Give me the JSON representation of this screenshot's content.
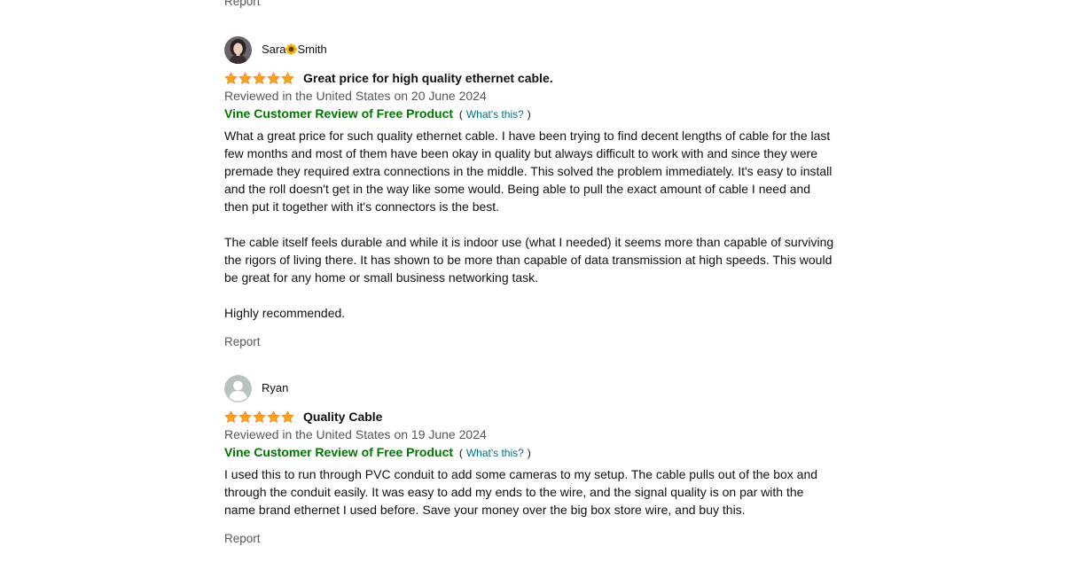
{
  "top_report": {
    "label": "Report"
  },
  "reviews": [
    {
      "author": {
        "name_first": "Sara",
        "name_last": "Smith",
        "emoji_icon": "sunflower-icon"
      },
      "rating": 5,
      "rating_max": 5,
      "title": "Great price for high quality ethernet cable.",
      "date": "Reviewed in the United States on 20 June 2024",
      "vine": {
        "badge": "Vine Customer Review of Free Product",
        "open_paren": "(",
        "whats_this": "What's this?",
        "close_paren": ")"
      },
      "body": [
        "What a great price for such quality ethernet cable. I have been trying to find decent lengths of cable for the last few months and most of them have been okay in quality but always difficult to work with and since they were premade they required extra connections in the middle. This solved the problem immediately. It's easy to install and the roll doesn't get in the way like some would. Being able to pull the exact amount of cable I need and then put it together with it's connectors is the best.",
        "The cable itself feels durable and while it is indoor use (what I needed) it seems more than capable of surviving the rigors of living there. It has shown to be more than capable of data transmission at high speeds. This would be great for any home or small business networking task.",
        "Highly recommended."
      ],
      "report": "Report"
    },
    {
      "author": {
        "name": "Ryan"
      },
      "rating": 5,
      "rating_max": 5,
      "title": "Quality Cable",
      "date": "Reviewed in the United States on 19 June 2024",
      "vine": {
        "badge": "Vine Customer Review of Free Product",
        "open_paren": "(",
        "whats_this": "What's this?",
        "close_paren": ")"
      },
      "body": [
        "I used this to run through PVC conduit to add some cameras to my setup. The cable pulls out of the box and through the conduit easily. It was easy to add my ends to the wire, and the signal quality is on par with the name brand ethernet I used before. Save your money over the big box store wire, and buy this."
      ],
      "report": "Report"
    }
  ],
  "colors": {
    "star": "#FFA41C",
    "vine_green": "#007600",
    "link": "#007185",
    "muted": "#565959"
  }
}
